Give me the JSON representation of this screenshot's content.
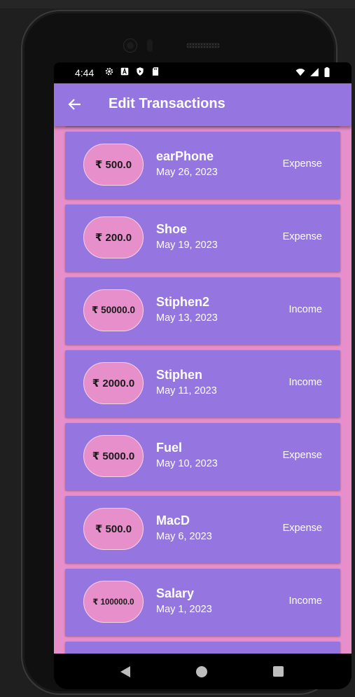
{
  "status_bar": {
    "time": "4:44",
    "left_icons": [
      "gear-icon",
      "a-icon",
      "shield-icon",
      "sd-card-icon"
    ],
    "right_icons": [
      "wifi-icon",
      "signal-icon",
      "battery-icon"
    ]
  },
  "app_bar": {
    "back_icon": "arrow-left-icon",
    "title": "Edit Transactions",
    "color": "#9575df"
  },
  "colors": {
    "background": "#e68fcb",
    "card": "#9575df",
    "pill": "#e68fcb"
  },
  "transactions": [
    {
      "amount": "₹ 500.0",
      "name": "earPhone",
      "date": "May 26, 2023",
      "type": "Expense"
    },
    {
      "amount": "₹ 200.0",
      "name": "Shoe",
      "date": "May 19, 2023",
      "type": "Expense"
    },
    {
      "amount": "₹ 50000.0",
      "name": "Stiphen2",
      "date": "May 13, 2023",
      "type": "Income"
    },
    {
      "amount": "₹ 2000.0",
      "name": "Stiphen",
      "date": "May 11, 2023",
      "type": "Income"
    },
    {
      "amount": "₹ 5000.0",
      "name": "Fuel",
      "date": "May 10, 2023",
      "type": "Expense"
    },
    {
      "amount": "₹ 500.0",
      "name": "MacD",
      "date": "May 6, 2023",
      "type": "Expense"
    },
    {
      "amount": "₹ 100000.0",
      "name": "Salary",
      "date": "May 1, 2023",
      "type": "Income"
    }
  ],
  "nav_bar": {
    "icons": [
      "nav-back-icon",
      "nav-home-icon",
      "nav-recents-icon"
    ]
  }
}
